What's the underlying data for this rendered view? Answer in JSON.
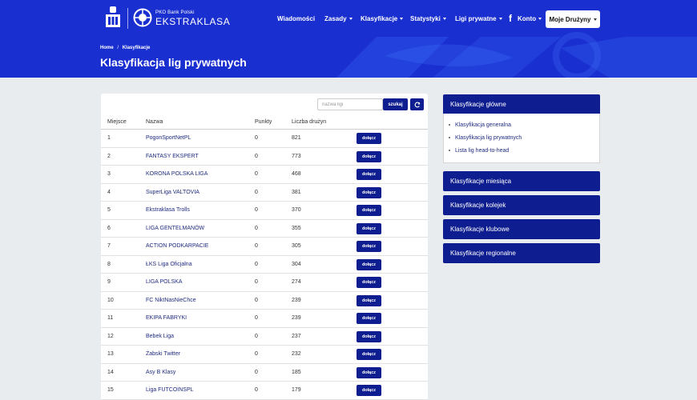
{
  "brand": {
    "bank_name": "PKO Bank Polski",
    "league_name": "EKSTRAKLASA"
  },
  "nav": {
    "items": [
      {
        "label": "Wiadomości",
        "dropdown": false
      },
      {
        "label": "Zasady",
        "dropdown": true
      },
      {
        "label": "Klasyfikacje",
        "dropdown": true
      },
      {
        "label": "Statystyki",
        "dropdown": true
      },
      {
        "label": "Ligi prywatne",
        "dropdown": true
      }
    ],
    "account_label": "Konto",
    "teams_label": "Moje Drużyny"
  },
  "breadcrumb": {
    "home": "Home",
    "separator": "/",
    "current": "Klasyfikacje"
  },
  "page_title": "Klasyfikacja lig prywatnych",
  "search": {
    "placeholder": "nazwa ligi",
    "value": "",
    "button_label": "szukaj"
  },
  "table": {
    "columns": [
      "Miejsce",
      "Nazwa",
      "Punkty",
      "Liczba drużyn"
    ],
    "join_label": "dołącz",
    "rows": [
      {
        "place": "1",
        "name": "PogonSportNetPL",
        "points": "0",
        "teams": "821"
      },
      {
        "place": "2",
        "name": "FANTASY EKSPERT",
        "points": "0",
        "teams": "773"
      },
      {
        "place": "3",
        "name": "KORONA POLSKA LIGA",
        "points": "0",
        "teams": "468"
      },
      {
        "place": "4",
        "name": "SuperLiga VALTOVIA",
        "points": "0",
        "teams": "381"
      },
      {
        "place": "5",
        "name": "Ekstraklasa Trolls",
        "points": "0",
        "teams": "370"
      },
      {
        "place": "6",
        "name": "LIGA GENTELMANÓW",
        "points": "0",
        "teams": "355"
      },
      {
        "place": "7",
        "name": "ACTION PODKARPACIE",
        "points": "0",
        "teams": "305"
      },
      {
        "place": "8",
        "name": "ŁKS Liga Oficjalna",
        "points": "0",
        "teams": "304"
      },
      {
        "place": "9",
        "name": "LIGA POLSKA",
        "points": "0",
        "teams": "274"
      },
      {
        "place": "10",
        "name": "FC NiktNasNieChce",
        "points": "0",
        "teams": "239"
      },
      {
        "place": "11",
        "name": "EKIPA FABRYKI",
        "points": "0",
        "teams": "239"
      },
      {
        "place": "12",
        "name": "Bebek Liga",
        "points": "0",
        "teams": "237"
      },
      {
        "place": "13",
        "name": "Żabski Twitter",
        "points": "0",
        "teams": "232"
      },
      {
        "place": "14",
        "name": "Asy B Klasy",
        "points": "0",
        "teams": "185"
      },
      {
        "place": "15",
        "name": "Liga FUTCOINSPL",
        "points": "0",
        "teams": "179"
      }
    ]
  },
  "sidebar": {
    "main_title": "Klasyfikacje główne",
    "links": [
      "Klasyfikacja generalna",
      "Klasyfikacja lig prywatnych",
      "Lista lig head-to-head"
    ],
    "sections": [
      "Klasyfikacje miesiąca",
      "Klasyfikacje kolejek",
      "Klasyfikacje klubowe",
      "Klasyfikacje regionalne"
    ]
  },
  "colors": {
    "header_bg": "#1a2fd0",
    "primary_dark": "#0e1d8f",
    "page_bg": "#e9ecef",
    "link": "#1f2b80"
  }
}
